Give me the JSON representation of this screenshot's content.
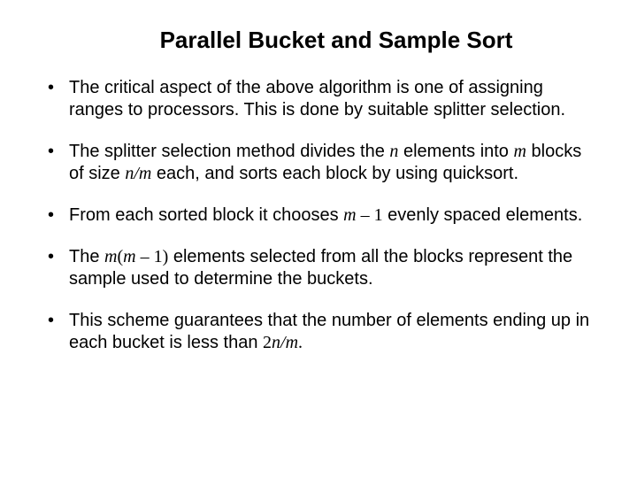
{
  "title": "Parallel Bucket and Sample Sort",
  "bullets": {
    "b0": {
      "t0": "The critical aspect of the above algorithm is one of assigning ranges to processors. This is done by suitable splitter selection."
    },
    "b1": {
      "t0": "The splitter selection method divides the ",
      "v0": "n",
      "t1": " elements into ",
      "v1": "m",
      "t2": " blocks of size ",
      "v2": "n/m",
      "t3": " each, and sorts each block by using quicksort."
    },
    "b2": {
      "t0": "From each sorted block it chooses ",
      "v0": "m",
      "t1": " – ",
      "n0": "1",
      "t2": " evenly spaced elements."
    },
    "b3": {
      "t0": "The ",
      "v0": "m",
      "p0": "(",
      "v1": "m",
      "t1": " – ",
      "n0": "1",
      "p1": ")",
      "t2": " elements selected from all the blocks represent the sample used to determine the buckets."
    },
    "b4": {
      "t0": "This scheme guarantees that the number of elements ending up in each bucket is less than ",
      "n0": "2",
      "v0": "n/m",
      "t1": "."
    }
  }
}
